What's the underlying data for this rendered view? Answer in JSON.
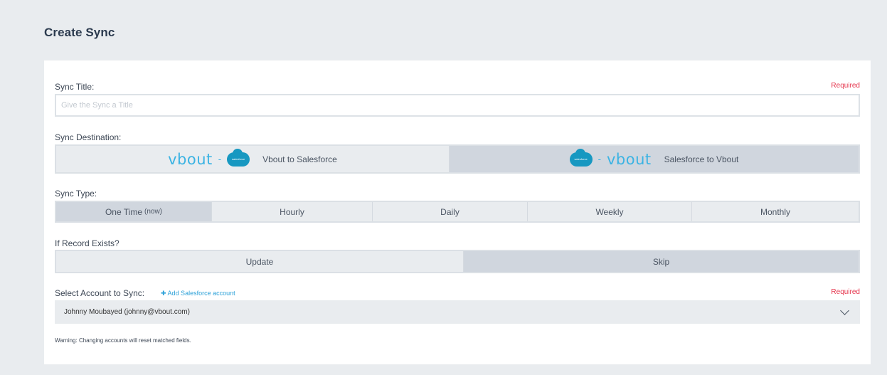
{
  "page": {
    "title": "Create Sync"
  },
  "sync_title": {
    "label": "Sync Title:",
    "required": "Required",
    "placeholder": "Give the Sync a Title",
    "value": ""
  },
  "sync_destination": {
    "label": "Sync Destination:",
    "options": [
      {
        "logo_left": "vbout",
        "logo_right": "salesforce",
        "label": "Vbout to Salesforce",
        "selected": false
      },
      {
        "logo_left": "salesforce",
        "logo_right": "vbout",
        "label": "Salesforce to Vbout",
        "selected": true
      }
    ],
    "icons": {
      "vbout": "vbout-logo",
      "salesforce": "salesforce-cloud-icon"
    }
  },
  "sync_type": {
    "label": "Sync Type:",
    "options": [
      {
        "label": "One Time",
        "suffix": "(now)",
        "selected": true
      },
      {
        "label": "Hourly",
        "selected": false
      },
      {
        "label": "Daily",
        "selected": false
      },
      {
        "label": "Weekly",
        "selected": false
      },
      {
        "label": "Monthly",
        "selected": false
      }
    ]
  },
  "record_exists": {
    "label": "If Record Exists?",
    "options": [
      {
        "label": "Update",
        "selected": false
      },
      {
        "label": "Skip",
        "selected": true
      }
    ]
  },
  "account": {
    "label": "Select Account to Sync:",
    "add_link": "Add Salesforce account",
    "required": "Required",
    "selected": "Johnny Moubayed (johnny@vbout.com)",
    "warning": "Warning: Changing accounts will reset matched fields."
  },
  "colors": {
    "accent": "#2aa0d8",
    "required": "#e5334b",
    "selected_bg": "#d0d6de",
    "option_bg": "#e9ecef",
    "brand_blue": "#1798c1"
  }
}
